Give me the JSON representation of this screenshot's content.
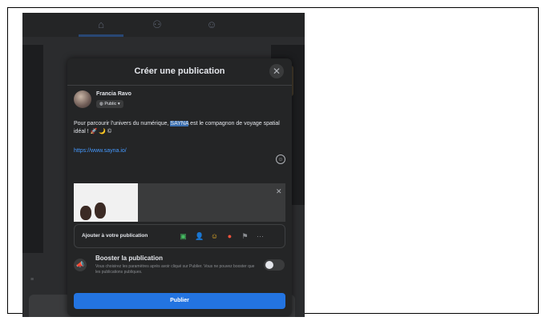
{
  "modal": {
    "title": "Créer une publication",
    "close_icon": "close-icon"
  },
  "user": {
    "name": "Francia Ravo",
    "privacy": "Public ▾"
  },
  "post": {
    "text_before": "Pour parcourir l'univers du numérique, ",
    "highlight": "SAYNA",
    "text_after": " est le compagnon de voyage spatial idéal ! 🚀 🌙 ©",
    "link": "https://www.sayna.io/"
  },
  "add_to_post": {
    "label": "Ajouter à votre publication",
    "icons": [
      "photo-icon",
      "tag-people-icon",
      "feeling-icon",
      "location-icon",
      "flag-icon",
      "more-icon"
    ],
    "more": "···"
  },
  "boost": {
    "title": "Booster la publication",
    "description": "Vous choisirez les paramètres après avoir cliqué sur Publier. Vous ne pouvez booster que les publications publiques."
  },
  "publish_label": "Publier",
  "colors": {
    "primary": "#2374e1",
    "modal_bg": "#242526",
    "link": "#4599ff"
  }
}
